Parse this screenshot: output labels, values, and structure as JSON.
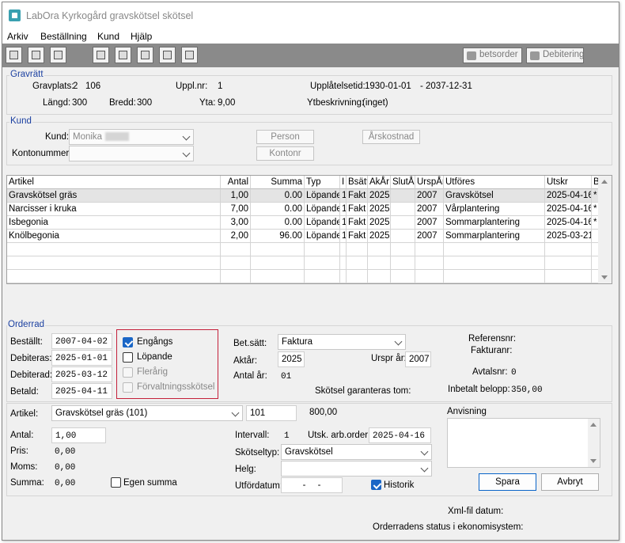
{
  "window": {
    "title": "LabOra Kyrkogård gravskötsel skötsel"
  },
  "menu": [
    "Arkiv",
    "Beställning",
    "Kund",
    "Hjälp"
  ],
  "toolbar": {
    "betsorder": "betsorder",
    "debitering": "Debitering"
  },
  "gravratt": {
    "title": "Gravrätt",
    "gravplats_label": "Gravplats:",
    "gravplats_value": "2   106",
    "uppl_label": "Uppl.nr:",
    "uppl_value": "1",
    "upplatelsetid_label": "Upplåtelsetid:",
    "upplatelsetid_from": "1930-01-01",
    "upplatelsetid_to": "- 2037-12-31",
    "langd_label": "Längd:",
    "langd_value": "300",
    "bredd_label": "Bredd:",
    "bredd_value": "300",
    "yta_label": "Yta:",
    "yta_value": "9,00",
    "ytbeskrivning_label": "Ytbeskrivning:",
    "ytbeskrivning_value": "(inget)"
  },
  "kund": {
    "title": "Kund",
    "kund_label": "Kund:",
    "kund_value": "Monika",
    "kontonummer_label": "Kontonummer:",
    "kontonummer_value": "",
    "person_button": "Person",
    "kontonr_button": "Kontonr",
    "arskostnad_button": "Årskostnad"
  },
  "grid": {
    "headers": [
      "Artikel",
      "Antal",
      "Summa",
      "Typ",
      "I",
      "Bsätt",
      "AkÅr",
      "SlutÅr",
      "UrspÅr",
      "Utföres",
      "Utskr",
      "B"
    ],
    "rows": [
      [
        "Gravskötsel gräs",
        "1,00",
        "0.00",
        "Löpande",
        "1",
        "Fakt",
        "2025",
        "",
        "2007",
        "Gravskötsel",
        "2025-04-16",
        "*"
      ],
      [
        "Narcisser i kruka",
        "7,00",
        "0.00",
        "Löpande",
        "1",
        "Fakt",
        "2025",
        "",
        "2007",
        "Vårplantering",
        "2025-04-16",
        "*"
      ],
      [
        "Isbegonia",
        "3,00",
        "0.00",
        "Löpande",
        "1",
        "Fakt",
        "2025",
        "",
        "2007",
        "Sommarplantering",
        "2025-04-16",
        "*"
      ],
      [
        "Knölbegonia",
        "2,00",
        "96.00",
        "Löpande",
        "1",
        "Fakt",
        "2025",
        "",
        "2007",
        "Sommarplantering",
        "2025-03-21",
        ""
      ]
    ]
  },
  "orderrad": {
    "title": "Orderrad",
    "bestallt_label": "Beställt:",
    "bestallt_value": "2007-04-02",
    "debiteras_label": "Debiteras:",
    "debiteras_value": "2025-01-01",
    "debiterad_label": "Debiterad:",
    "debiterad_value": "2025-03-12",
    "betald_label": "Betald:",
    "betald_value": "2025-04-11",
    "engangs": "Engångs",
    "lopande": "Löpande",
    "flerarig": "Flerårig",
    "forvaltning": "Förvaltningsskötsel",
    "betsatt_label": "Bet.sätt:",
    "betsatt_value": "Faktura",
    "aktar_label": "Aktår:",
    "aktar_value": "2025",
    "ursprar_label": "Urspr år:",
    "ursprar_value": "2007",
    "antalar_label": "Antal år:",
    "antalar_value": "01",
    "skotsel_garanteras": "Skötsel garanteras tom:",
    "referensnr_label": "Referensnr:",
    "fakturanr_label": "Fakturanr:",
    "avtalsnr_label": "Avtalsnr:",
    "avtalsnr_value": "0",
    "inbetalt_label": "Inbetalt belopp:",
    "inbetalt_value": "350,00"
  },
  "artikel": {
    "artikel_label": "Artikel:",
    "artikel_value": "Gravskötsel gräs (101)",
    "artikel_code": "101",
    "artikel_price": "800,00",
    "antal_label": "Antal:",
    "antal_value": "1,00",
    "pris_label": "Pris:",
    "pris_value": "0,00",
    "moms_label": "Moms:",
    "moms_value": "0,00",
    "summa_label": "Summa:",
    "summa_value": "0,00",
    "egen_summa": "Egen summa",
    "intervall_label": "Intervall:",
    "intervall_value": "1",
    "utsk_label": "Utsk. arb.order:",
    "utsk_value": "2025-04-16",
    "skotseltyp_label": "Skötseltyp:",
    "skotseltyp_value": "Gravskötsel",
    "helg_label": "Helg:",
    "helg_value": "",
    "utfordatum_label": "Utfördatum:",
    "utfordatum_value": "- -",
    "historik": "Historik",
    "anvisning_label": "Anvisning",
    "spara": "Spara",
    "avbryt": "Avbryt",
    "xml_label": "Xml-fil datum:",
    "status_label": "Orderradens status i ekonomisystem:"
  }
}
